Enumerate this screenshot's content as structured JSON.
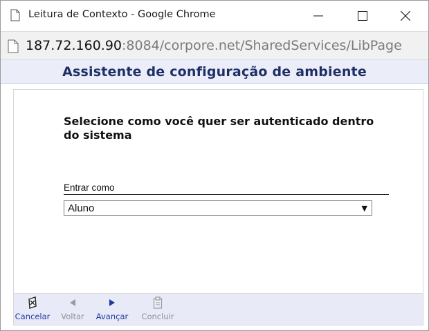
{
  "window": {
    "title": "Leitura de Contexto - Google Chrome",
    "controls": {
      "minimize": "—",
      "maximize": "☐",
      "close": "✕"
    }
  },
  "address": {
    "host": "187.72.160.90",
    "rest": ":8084/corpore.net/SharedServices/LibPage"
  },
  "header": {
    "title": "Assistente de configuração de ambiente"
  },
  "form": {
    "question": "Selecione como você quer ser autenticado dentro do sistema",
    "field_label": "Entrar como",
    "select_value": "Aluno",
    "select_arrow": "▼"
  },
  "toolbar": {
    "cancel_label": "Cancelar",
    "back_label": "Voltar",
    "next_label": "Avançar",
    "finish_label": "Concluir"
  },
  "icons": {
    "page": "page-icon",
    "cancel": "cancel-icon",
    "back": "arrow-left-icon",
    "next": "arrow-right-icon",
    "finish": "clipboard-icon"
  },
  "colors": {
    "header_bg": "#ebeef8",
    "header_text": "#1f2f66",
    "toolbar_bg": "#e8eaf8",
    "link_active": "#1d3b9e",
    "link_disabled": "#8e8e98"
  }
}
